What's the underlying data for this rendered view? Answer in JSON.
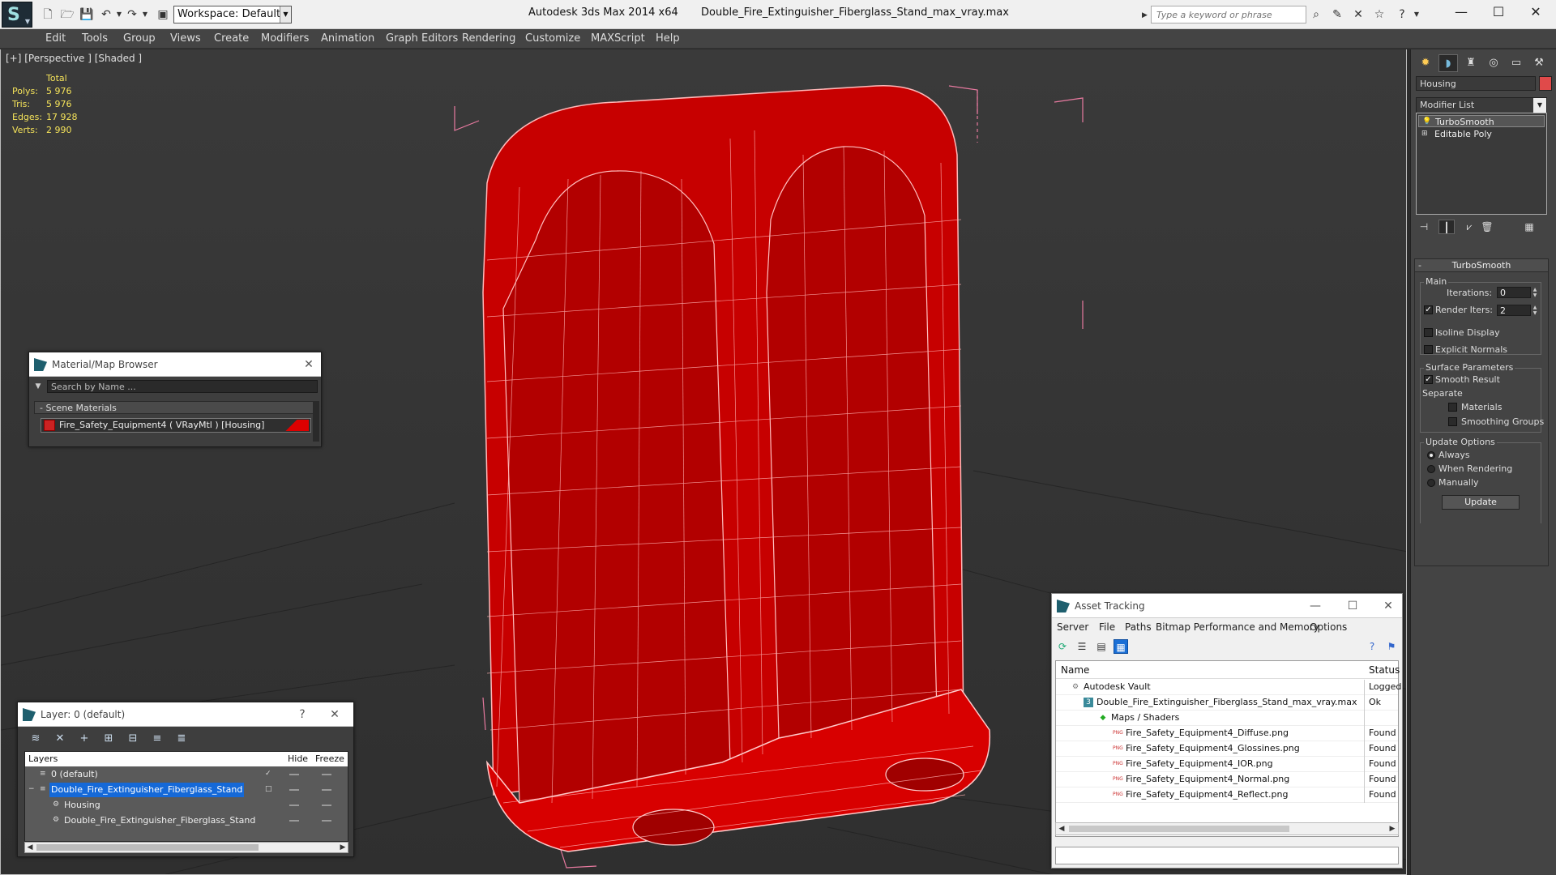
{
  "titlebar": {
    "workspace": "Workspace: Default",
    "app_title": "Autodesk 3ds Max  2014 x64",
    "file_title": "Double_Fire_Extinguisher_Fiberglass_Stand_max_vray.max",
    "search_placeholder": "Type a keyword or phrase"
  },
  "menu": [
    "Edit",
    "Tools",
    "Group",
    "Views",
    "Create",
    "Modifiers",
    "Animation",
    "Graph Editors",
    "Rendering",
    "Customize",
    "MAXScript",
    "Help"
  ],
  "viewport": {
    "label": "[+] [Perspective ] [Shaded ]",
    "stats": {
      "total_label": "Total",
      "rows": [
        {
          "k": "Polys:",
          "v": "5 976"
        },
        {
          "k": "Tris:",
          "v": "5 976"
        },
        {
          "k": "Edges:",
          "v": "17 928"
        },
        {
          "k": "Verts:",
          "v": "2 990"
        }
      ]
    },
    "object_color": "#d40000",
    "wire_color": "#ffb0b0",
    "bbox_color": "#e87aa0"
  },
  "material_browser": {
    "title": "Material/Map Browser",
    "search_placeholder": "Search by Name ...",
    "section": "- Scene Materials",
    "item": "Fire_Safety_Equipment4  ( VRayMtl )  [Housing]"
  },
  "layers": {
    "title": "Layer: 0 (default)",
    "help": "?",
    "headers": {
      "layers": "Layers",
      "hide": "Hide",
      "freeze": "Freeze"
    },
    "rows": [
      {
        "name": "0 (default)",
        "indent": 1,
        "selected": false,
        "check": "✓"
      },
      {
        "name": "Double_Fire_Extinguisher_Fiberglass_Stand",
        "indent": 1,
        "selected": true,
        "check": "□"
      },
      {
        "name": "Housing",
        "indent": 2,
        "selected": false,
        "check": ""
      },
      {
        "name": "Double_Fire_Extinguisher_Fiberglass_Stand",
        "indent": 2,
        "selected": false,
        "check": ""
      }
    ]
  },
  "asset_tracking": {
    "title": "Asset Tracking",
    "menu": [
      "Server",
      "File",
      "Paths",
      "Bitmap Performance and Memory",
      "Options"
    ],
    "headers": {
      "name": "Name",
      "status": "Status"
    },
    "rows": [
      {
        "name": "Autodesk Vault",
        "status": "Logged",
        "indent": 1,
        "icon": "vault-icon"
      },
      {
        "name": "Double_Fire_Extinguisher_Fiberglass_Stand_max_vray.max",
        "status": "Ok",
        "indent": 2,
        "icon": "max-file-icon"
      },
      {
        "name": "Maps / Shaders",
        "status": "",
        "indent": 3,
        "icon": "maps-icon"
      },
      {
        "name": "Fire_Safety_Equipment4_Diffuse.png",
        "status": "Found",
        "indent": 4,
        "icon": "png-icon"
      },
      {
        "name": "Fire_Safety_Equipment4_Glossines.png",
        "status": "Found",
        "indent": 4,
        "icon": "png-icon"
      },
      {
        "name": "Fire_Safety_Equipment4_IOR.png",
        "status": "Found",
        "indent": 4,
        "icon": "png-icon"
      },
      {
        "name": "Fire_Safety_Equipment4_Normal.png",
        "status": "Found",
        "indent": 4,
        "icon": "png-icon"
      },
      {
        "name": "Fire_Safety_Equipment4_Reflect.png",
        "status": "Found",
        "indent": 4,
        "icon": "png-icon"
      }
    ]
  },
  "command_panel": {
    "object_name": "Housing",
    "object_color": "#e04a4a",
    "modifier_list": "Modifier List",
    "stack": [
      {
        "name": "TurboSmooth",
        "selected": true,
        "icon": "lightbulb-icon"
      },
      {
        "name": "Editable Poly",
        "selected": false,
        "icon": "plus-box-icon"
      }
    ],
    "rollout": {
      "title": "TurboSmooth",
      "main_group": "Main",
      "iterations_label": "Iterations:",
      "iterations_value": "0",
      "render_iters_label": "Render Iters:",
      "render_iters_value": "2",
      "render_iters_checked": true,
      "isoline_label": "Isoline Display",
      "explicit_label": "Explicit Normals",
      "surface_group": "Surface Parameters",
      "smooth_result_label": "Smooth Result",
      "separate_label": "Separate",
      "materials_label": "Materials",
      "smoothing_groups_label": "Smoothing Groups",
      "update_group": "Update Options",
      "always_label": "Always",
      "when_rendering_label": "When Rendering",
      "manually_label": "Manually",
      "update_button": "Update"
    }
  }
}
